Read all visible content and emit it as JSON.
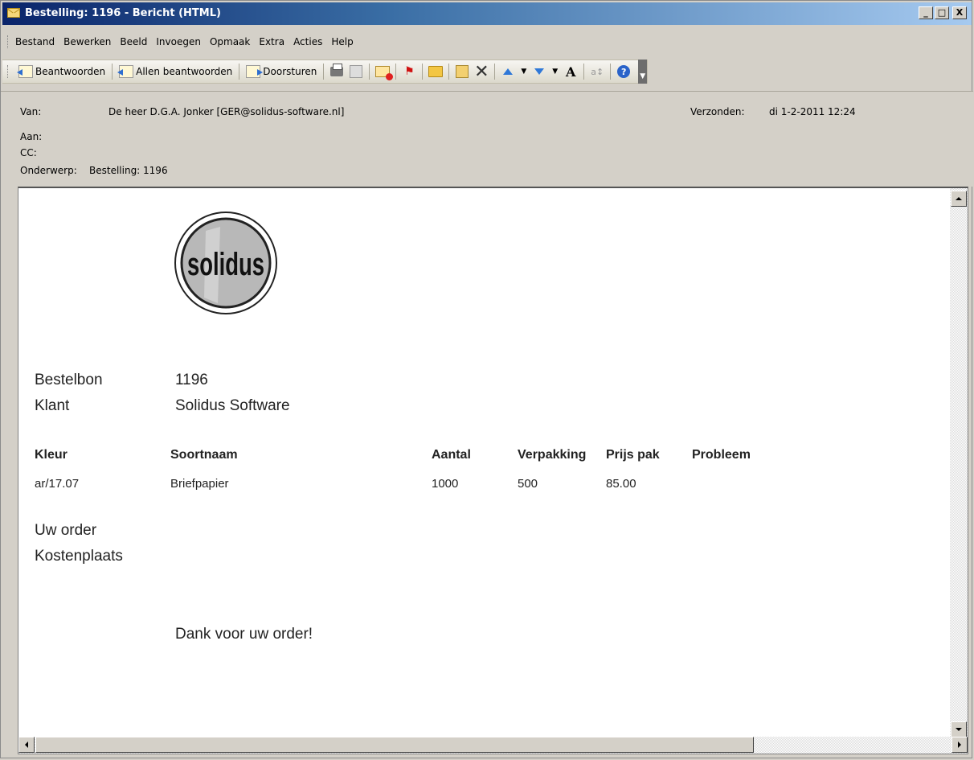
{
  "window": {
    "title": "Bestelling:  1196 - Bericht (HTML)",
    "minimize": "_",
    "maximize": "□",
    "close": "X"
  },
  "menu": [
    "Bestand",
    "Bewerken",
    "Beeld",
    "Invoegen",
    "Opmaak",
    "Extra",
    "Acties",
    "Help"
  ],
  "toolbar": {
    "reply": "Beantwoorden",
    "reply_all": "Allen beantwoorden",
    "forward": "Doorsturen",
    "icons": [
      "reply-icon",
      "reply-all-icon",
      "forward-icon",
      "print-icon",
      "copy-icon",
      "mark-unread-icon",
      "flag-icon",
      "folder-icon",
      "move-icon",
      "delete-icon",
      "previous-item-icon",
      "next-item-icon",
      "font-size-icon",
      "translate-icon",
      "help-icon"
    ]
  },
  "header": {
    "from_label": "Van:",
    "from_value": "De heer D.G.A. Jonker [GER@solidus-software.nl]",
    "sent_label": "Verzonden:",
    "sent_value": "di 1-2-2011 12:24",
    "to_label": "Aan:",
    "to_value": "",
    "cc_label": "CC:",
    "cc_value": "",
    "subject_label": "Onderwerp:",
    "subject_value": "Bestelling:  1196"
  },
  "body": {
    "logo_text": "solidus",
    "bestelbon_label": "Bestelbon",
    "bestelbon_value": "1196",
    "klant_label": "Klant",
    "klant_value": "Solidus Software",
    "table": {
      "headers": [
        "Kleur",
        "Soortnaam",
        "Aantal",
        "Verpakking",
        "Prijs pak",
        "Probleem"
      ],
      "rows": [
        [
          "ar/17.07",
          "Briefpapier",
          "1000",
          "500",
          "85.00",
          ""
        ]
      ]
    },
    "uw_order_label": "Uw order",
    "kostenplaats_label": "Kostenplaats",
    "thanks": "Dank voor uw order!"
  }
}
